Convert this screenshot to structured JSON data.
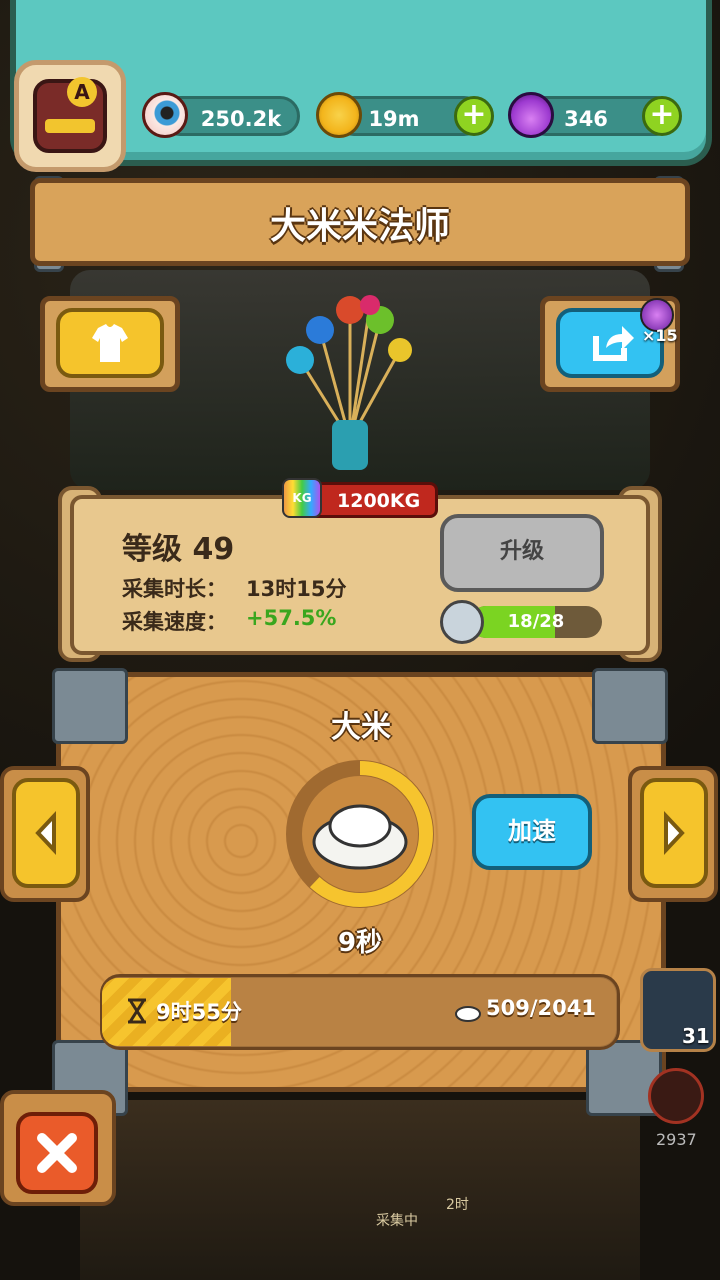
{
  "currencies": {
    "eyes": {
      "value": "250.2k",
      "icon": "eyeball-icon"
    },
    "coins": {
      "value": "19m",
      "icon": "gold-coin-icon"
    },
    "potions": {
      "value": "346",
      "icon": "purple-potion-icon"
    }
  },
  "avatar": {
    "letter": "A"
  },
  "title": "大米米法师",
  "share_badge": "×15",
  "weight_tag": "1200KG",
  "weight_icon_text": "KG",
  "info": {
    "level_label": "等级 49",
    "collect_time_label": "采集时长：",
    "collect_time_value": "13时15分",
    "collect_speed_label": "采集速度：",
    "collect_speed_value": "+57.5%"
  },
  "upgrade_label": "升级",
  "xp": {
    "text": "18/28",
    "current": 18,
    "max": 28
  },
  "resource": {
    "name": "大米",
    "timer": "9秒",
    "ring_progress": 0.62,
    "speed_label": "加速"
  },
  "progress": {
    "time_left": "9时55分",
    "count": "509/2041",
    "fill_fraction": 0.25
  },
  "side_card_count": "31",
  "side_number": "2937",
  "bottom_label": "采集中",
  "bottom_time": "2时",
  "colors": {
    "teal": "#5cc8c0",
    "wood": "#d89a4e",
    "yellow": "#f5c42c",
    "blue": "#33c2f2",
    "red": "#ea5b2a",
    "green": "#7bd422"
  }
}
